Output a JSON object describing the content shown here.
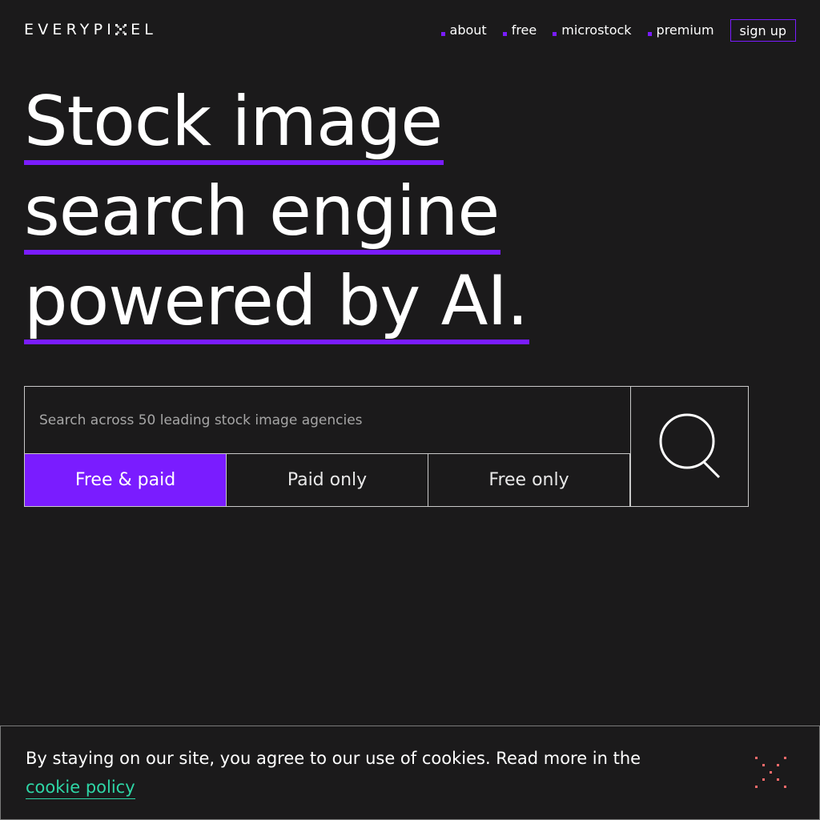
{
  "header": {
    "logo_left": "EVERYPI",
    "logo_right": "EL",
    "nav": [
      {
        "label": "about"
      },
      {
        "label": "free"
      },
      {
        "label": "microstock"
      },
      {
        "label": "premium"
      }
    ],
    "signup_label": "sign up"
  },
  "hero": {
    "lines": [
      "Stock image",
      "search engine",
      "powered by AI."
    ]
  },
  "search": {
    "placeholder": "Search across 50 leading stock image agencies",
    "filters": [
      "Free & paid",
      "Paid only",
      "Free only"
    ],
    "active_filter": "Free & paid"
  },
  "cookie": {
    "text": "By staying on our site, you agree to our use of cookies. Read more in the",
    "link_label": "cookie policy"
  },
  "colors": {
    "background": "#1b1a1b",
    "accent": "#7a1cff",
    "link": "#2ed6a6",
    "close_icon": "#ff6b6b"
  },
  "icons": [
    "logo-pixel-icon",
    "search-icon",
    "close-icon"
  ]
}
